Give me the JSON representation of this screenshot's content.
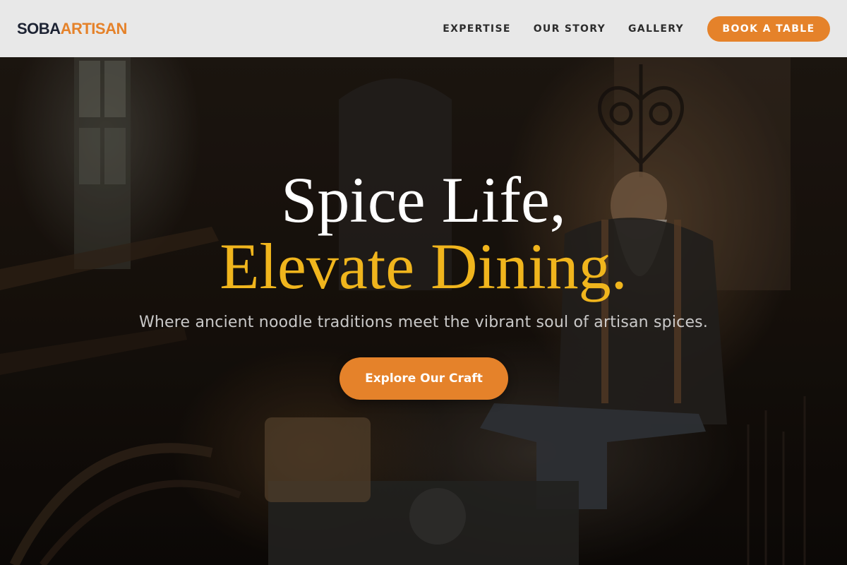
{
  "header": {
    "logo_part1": "SOBA",
    "logo_part2": "ARTISAN",
    "nav": [
      {
        "label": "EXPERTISE"
      },
      {
        "label": "OUR STORY"
      },
      {
        "label": "GALLERY"
      }
    ],
    "cta_label": "BOOK A TABLE"
  },
  "hero": {
    "headline_line1": "Spice Life,",
    "headline_line2": "Elevate Dining.",
    "subtitle": "Where ancient noodle traditions meet the vibrant soul of artisan spices.",
    "cta_label": "Explore Our Craft"
  },
  "colors": {
    "accent": "#e5822a",
    "headline_gold": "#f0b51d",
    "logo_dark": "#1d2333",
    "header_bg": "#e8e8e8"
  }
}
